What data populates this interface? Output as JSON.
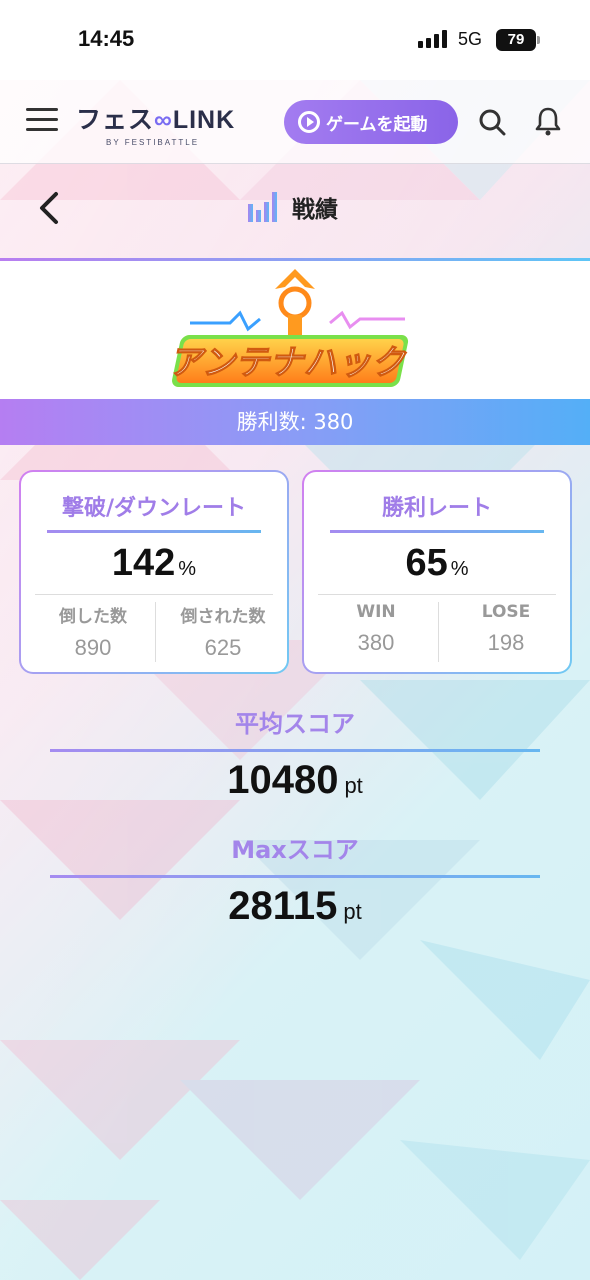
{
  "status_bar": {
    "time": "14:45",
    "network": "5G",
    "battery": "79"
  },
  "header": {
    "logo_main_left": "フェス",
    "logo_main_right": "LINK",
    "logo_sub": "BY FESTIBATTLE",
    "launch_button": "ゲームを起動"
  },
  "page": {
    "title": "戦績"
  },
  "game": {
    "logo_text": "アンテナハック",
    "wins_label": "勝利数: 380"
  },
  "cards": {
    "defeat": {
      "title": "撃破/ダウンレート",
      "value": "142",
      "unit": "%",
      "left_label": "倒した数",
      "left_value": "890",
      "right_label": "倒された数",
      "right_value": "625"
    },
    "win": {
      "title": "勝利レート",
      "value": "65",
      "unit": "%",
      "left_label": "WIN",
      "left_value": "380",
      "right_label": "LOSE",
      "right_value": "198"
    }
  },
  "stats": {
    "avg": {
      "label": "平均スコア",
      "value": "10480",
      "unit": "pt"
    },
    "max": {
      "label": "Maxスコア",
      "value": "28115",
      "unit": "pt"
    }
  },
  "colors": {
    "accent_purple": "#a07de8",
    "accent_blue": "#5ec5f6",
    "launch_bg": "#8a64e8"
  }
}
